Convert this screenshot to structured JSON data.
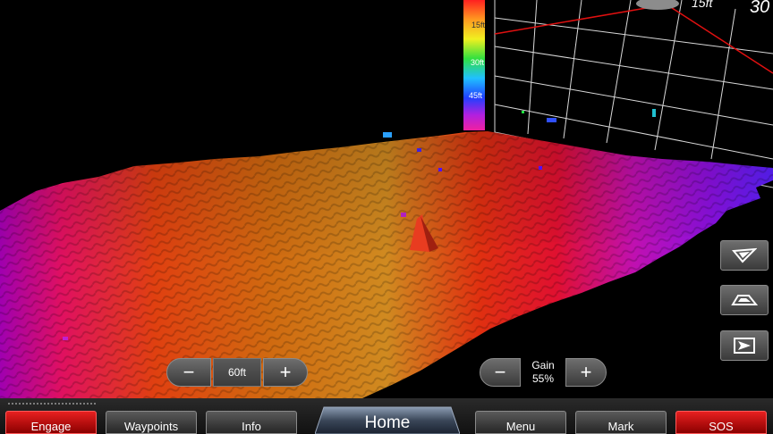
{
  "scale": {
    "depth_labels": [
      "15ft",
      "30ft",
      "45ft"
    ]
  },
  "grid_labels": {
    "top_left": "15ft",
    "top_right": "30"
  },
  "range_control": {
    "minus": "−",
    "value": "60ft",
    "plus": "+"
  },
  "gain_control": {
    "minus": "−",
    "label": "Gain",
    "value": "55%",
    "plus": "+"
  },
  "view_buttons": [
    {
      "icon": "view-angle-front-icon"
    },
    {
      "icon": "view-angle-top-icon"
    },
    {
      "icon": "view-angle-side-icon"
    }
  ],
  "softkeys": {
    "engage": "Engage",
    "waypoints": "Waypoints",
    "info": "Info",
    "home": "Home",
    "menu": "Menu",
    "mark": "Mark",
    "sos": "SOS"
  },
  "colors": {
    "accent_red": "#d40000",
    "grid": "#d9d9d9",
    "boundary": "#e01010"
  }
}
